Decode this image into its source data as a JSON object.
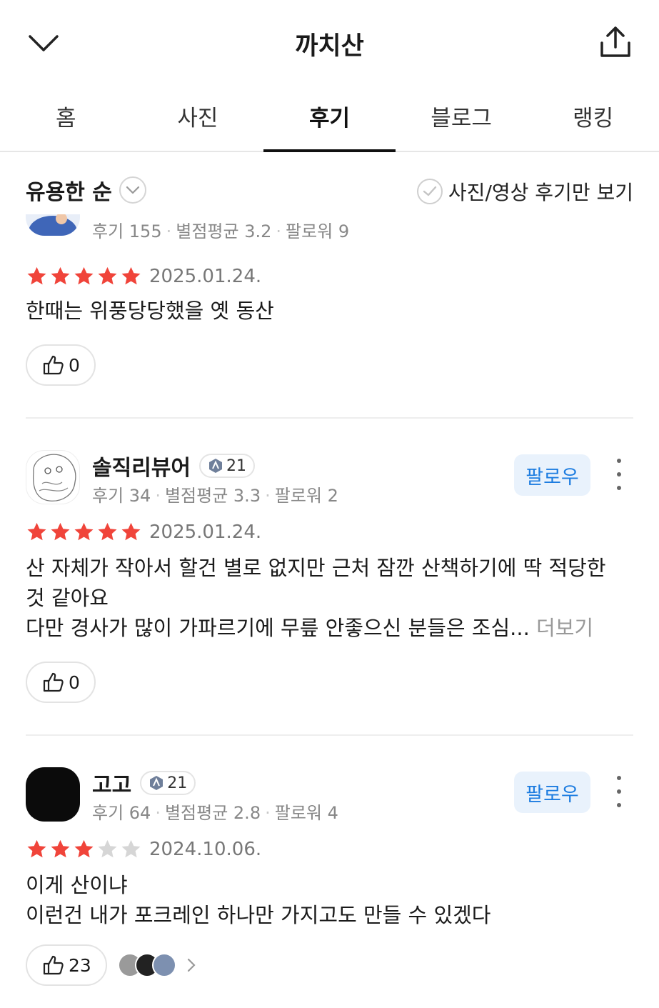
{
  "header": {
    "title": "까치산",
    "back_icon": "chevron-down-icon",
    "share_icon": "share-icon"
  },
  "tabs": [
    {
      "label": "홈"
    },
    {
      "label": "사진"
    },
    {
      "label": "후기",
      "active": true
    },
    {
      "label": "블로그"
    },
    {
      "label": "랭킹"
    }
  ],
  "filter": {
    "sort_label": "유용한 순",
    "photo_only_label": "사진/영상 후기만 보기"
  },
  "colors": {
    "accent_blue": "#1c7ce0",
    "follow_bg": "#e9f2fc",
    "star_red": "#f0443a",
    "star_gray": "#d6d6d6"
  },
  "reviews": [
    {
      "stats": {
        "reviews": "후기 155",
        "avg": "별점평균 3.2",
        "followers": "팔로워 9"
      },
      "rating": 5,
      "date": "2025.01.24.",
      "text_lines": [
        "한때는 위풍당당했을 옛 동산"
      ],
      "likes": "0"
    },
    {
      "nickname": "솔직리뷰어",
      "level": "21",
      "stats": {
        "reviews": "후기 34",
        "avg": "별점평균 3.3",
        "followers": "팔로워 2"
      },
      "follow_label": "팔로우",
      "rating": 5,
      "date": "2025.01.24.",
      "text_lines": [
        "산 자체가 작아서 할건 별로 없지만 근처 잠깐 산책하기에 딱 적당한",
        "것 같아요",
        "다만 경사가 많이 가파르기에 무릎 안좋으신 분들은 조심..."
      ],
      "more_label": "더보기",
      "likes": "0"
    },
    {
      "nickname": "고고",
      "level": "21",
      "stats": {
        "reviews": "후기 64",
        "avg": "별점평균 2.8",
        "followers": "팔로워 4"
      },
      "follow_label": "팔로우",
      "rating": 3,
      "date": "2024.10.06.",
      "text_lines": [
        "이게 산이냐",
        "이런건 내가 포크레인 하나만 가지고도 만들 수 있겠다"
      ],
      "likes": "23"
    }
  ]
}
